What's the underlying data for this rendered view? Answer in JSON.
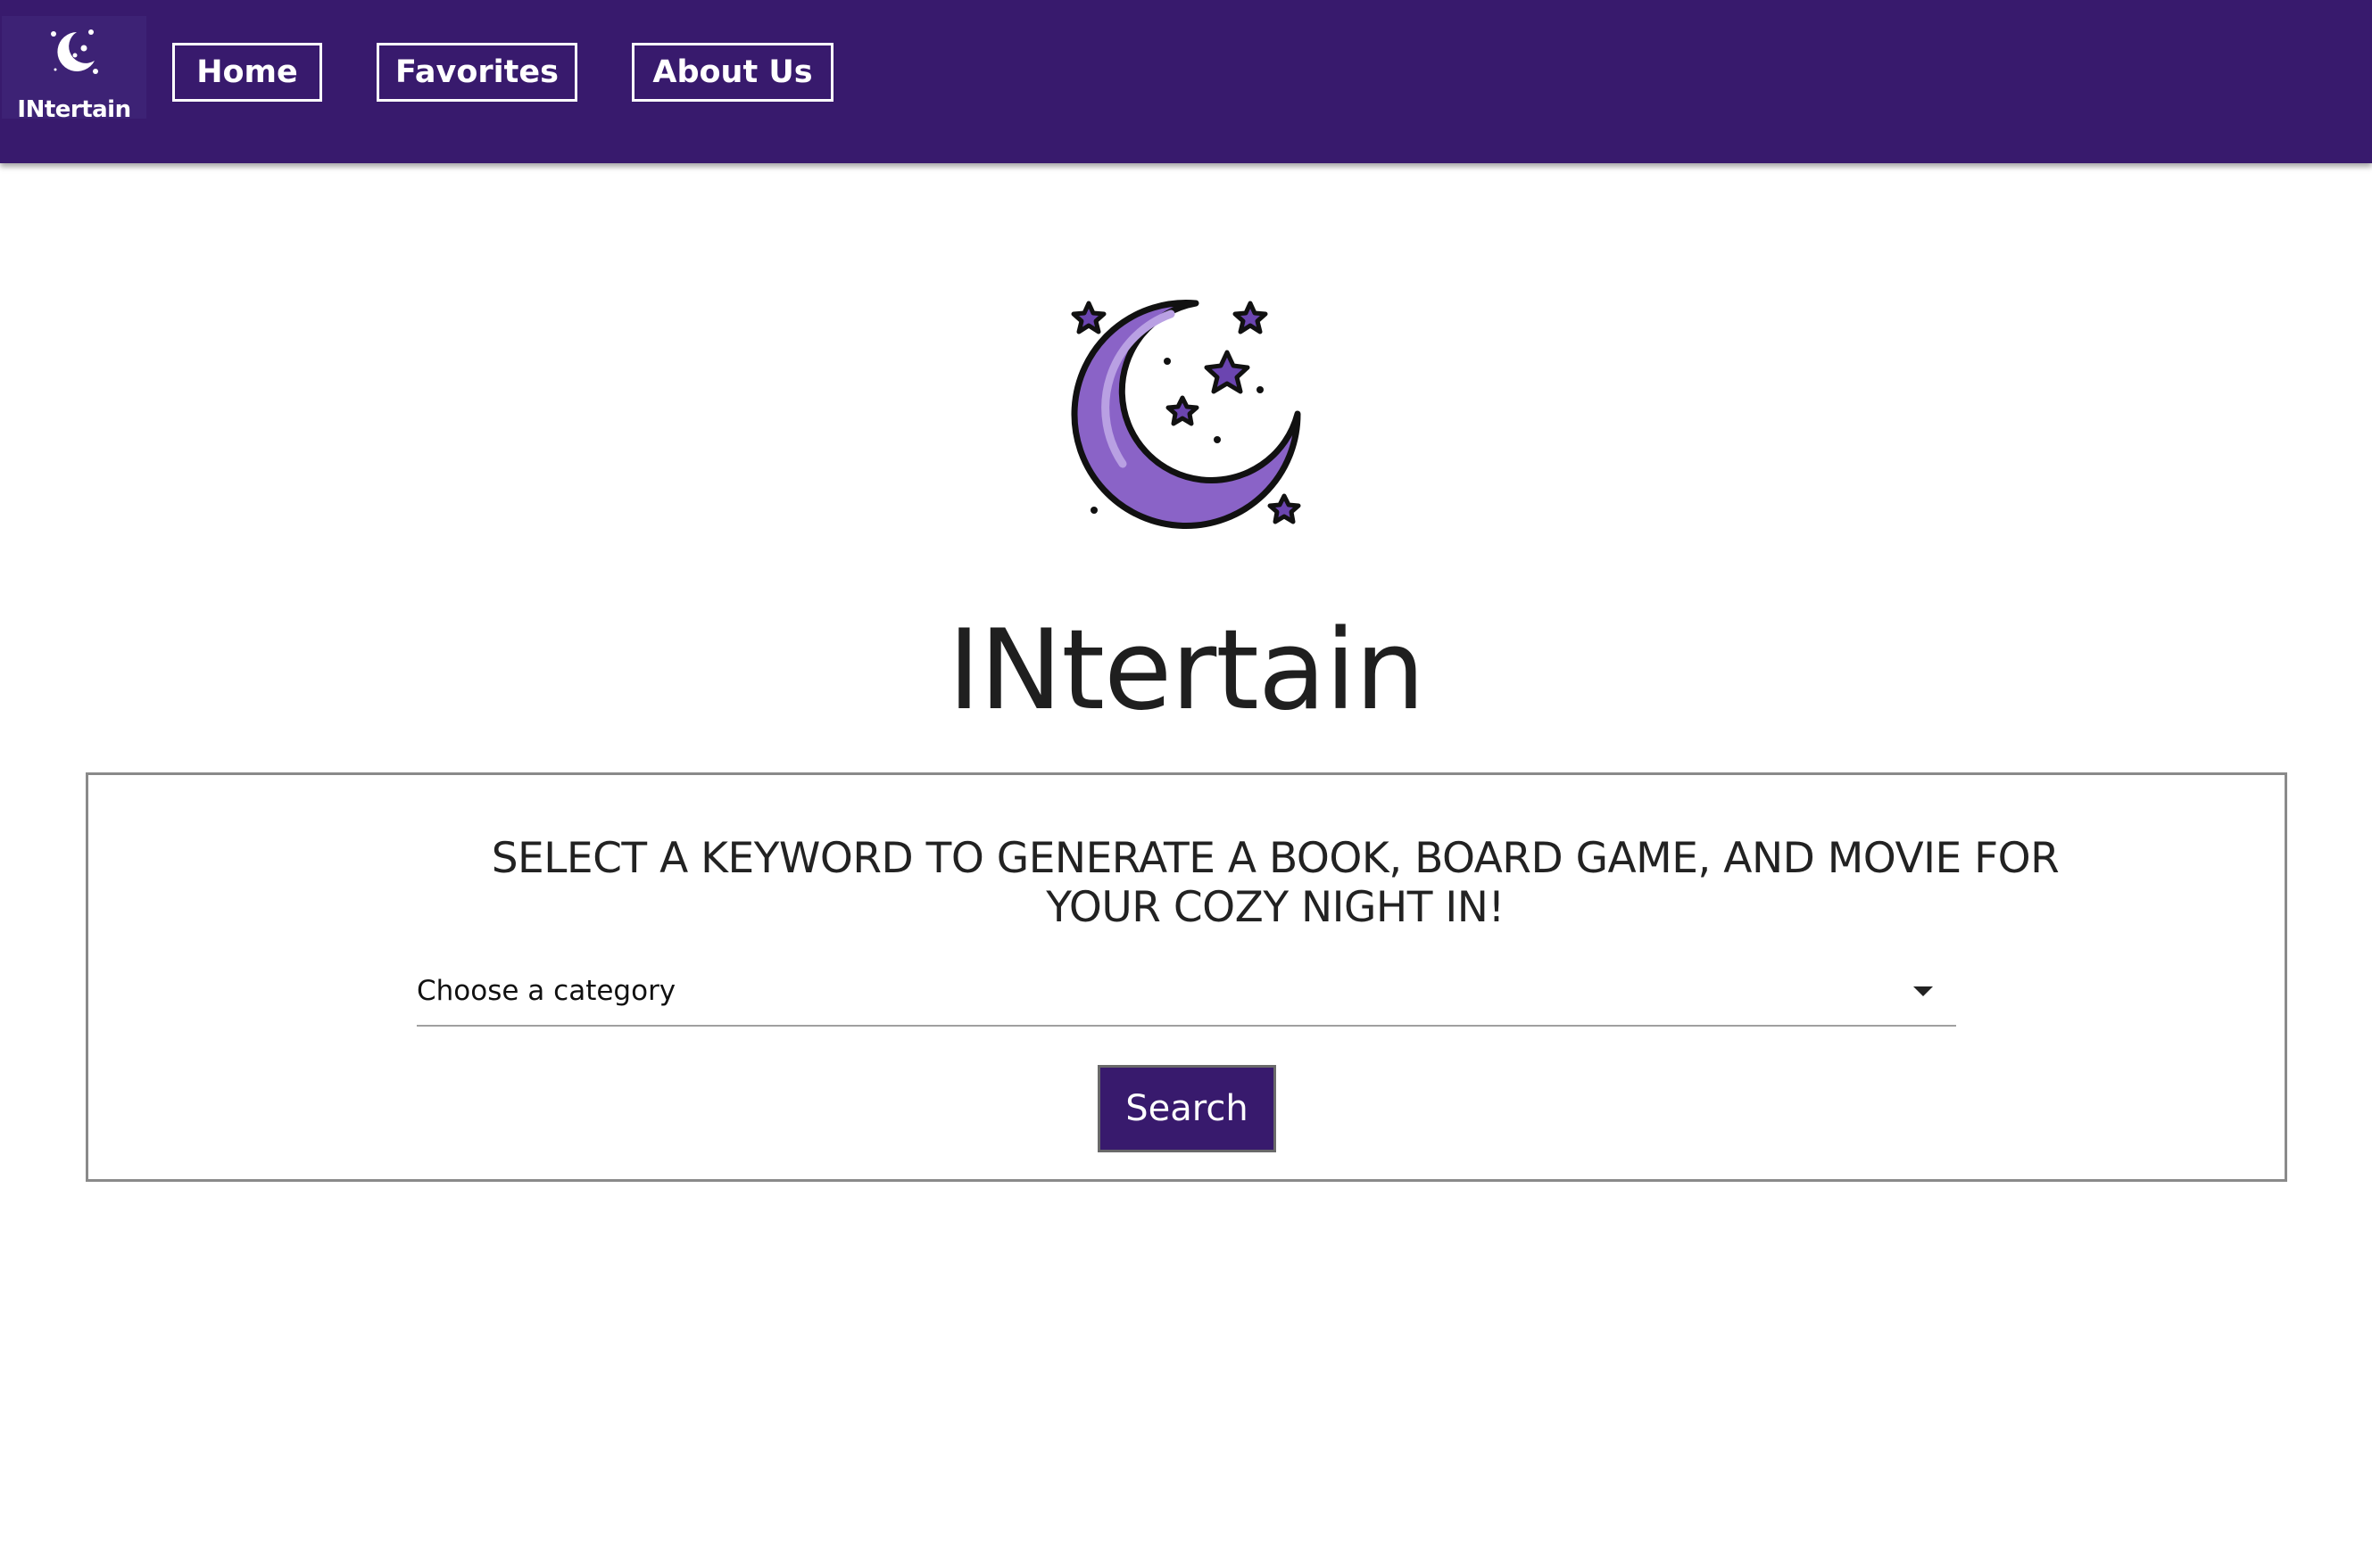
{
  "nav": {
    "logo_text": "INtertain",
    "items": [
      {
        "label": "Home"
      },
      {
        "label": "Favorites"
      },
      {
        "label": "About Us"
      }
    ]
  },
  "hero": {
    "logo_icon": "moon-stars-icon",
    "title": "INtertain"
  },
  "search_card": {
    "prompt": "SELECT A KEYWORD TO GENERATE A BOOK, BOARD GAME, AND MOVIE FOR YOUR COZY NIGHT IN!",
    "category_select": {
      "selected": "Choose a category"
    },
    "search_label": "Search"
  },
  "colors": {
    "brand": "#381a6d",
    "moon": "#8a63c7"
  }
}
